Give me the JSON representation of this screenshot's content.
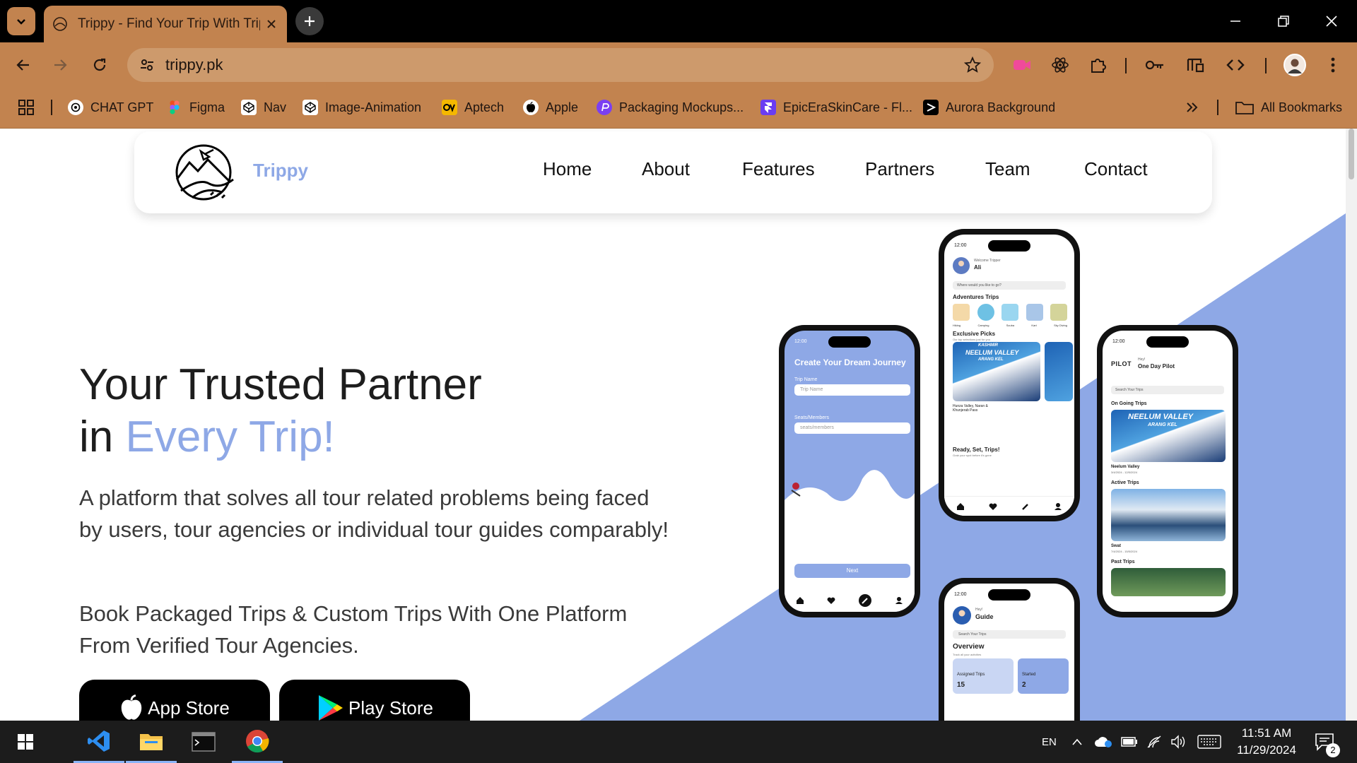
{
  "browser": {
    "tab_title": "Trippy - Find Your Trip With Trippy",
    "url": "trippy.pk",
    "bookmarks": [
      {
        "label": "CHAT GPT",
        "icon": "chatgpt-icon"
      },
      {
        "label": "Figma",
        "icon": "figma-icon"
      },
      {
        "label": "Nav",
        "icon": "codepen-icon"
      },
      {
        "label": "Image-Animation",
        "icon": "codepen-icon"
      },
      {
        "label": "Aptech",
        "icon": "aptech-icon"
      },
      {
        "label": "Apple",
        "icon": "apple-icon"
      },
      {
        "label": "Packaging Mockups...",
        "icon": "packaging-icon"
      },
      {
        "label": "EpicEraSkinCare - Fl...",
        "icon": "framer-icon"
      },
      {
        "label": "Aurora Background",
        "icon": "aurora-icon"
      }
    ],
    "all_bookmarks": "All Bookmarks"
  },
  "site": {
    "brand": "Trippy",
    "nav": [
      "Home",
      "About",
      "Features",
      "Partners",
      "Team",
      "Contact"
    ],
    "hero": {
      "title_line1": "Your Trusted Partner",
      "title_line2_prefix": "in ",
      "title_line2_accent": "Every Trip!",
      "description": "A platform that solves all tour related problems being faced by users, tour agencies or individual tour guides comparably!",
      "subtitle": "Book Packaged Trips & Custom Trips With One Platform From Verified Tour Agencies.",
      "app_store": "App Store",
      "play_store": "Play Store"
    },
    "colors": {
      "accent": "#8ea8e6",
      "chrome": "#c2834f"
    }
  },
  "phones": {
    "left": {
      "time": "12:00",
      "heading": "Create Your Dream Journey",
      "field1_label": "Trip Name",
      "field1_placeholder": "Trip Name",
      "field2_label": "Seats/Members",
      "field2_placeholder": "seats/members",
      "button": "Next"
    },
    "center": {
      "time": "12:00",
      "welcome": "Welcome Tripper",
      "user": "Ali",
      "search": "Where would you like to go?",
      "section1": "Adventures Trips",
      "categories": [
        "Hiking",
        "Camping",
        "Scuba",
        "Kart",
        "Sky Diving"
      ],
      "section2": "Exclusive Picks",
      "section2_sub": "Our top selections just for you",
      "card_title": "NEELUM VALLEY",
      "card_kicker": "KASHMIR",
      "card_sub": "ARANG KEL",
      "card_caption": "Hunza Valley, Naran & Khunjerab Pass",
      "section3": "Ready, Set, Trips!",
      "section3_sub": "Grab your spot before it's gone"
    },
    "right": {
      "time": "12:00",
      "brand": "PILOT",
      "title": "One Day Pilot",
      "greeting": "Hey!",
      "search": "Search Your Trips",
      "ongoing": "On Going Trips",
      "card_title": "NEELUM VALLEY",
      "card_sub": "ARANG KEL",
      "trip1": "Neelum Valley",
      "trip1_dates": "3/4/2024 - 12/5/2024",
      "active": "Active Trips",
      "trip2": "Swat",
      "trip2_dates": "7/4/2024 - 15/5/2024",
      "past": "Past Trips"
    },
    "bottom": {
      "time": "12:00",
      "greeting": "Hey!",
      "title": "Guide",
      "search": "Search Your Trips",
      "overview": "Overview",
      "overview_sub": "Track all your activities",
      "stat1_label": "Assigned Trips",
      "stat1_value": "15",
      "stat2_label": "Started",
      "stat2_value": "2"
    }
  },
  "taskbar": {
    "lang": "EN",
    "time": "11:51 AM",
    "date": "11/29/2024",
    "notifications": "2"
  }
}
